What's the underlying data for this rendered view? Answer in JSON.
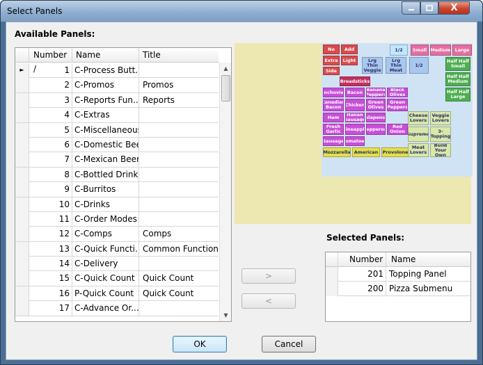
{
  "window": {
    "title": "Select Panels",
    "close_glyph": "X"
  },
  "available": {
    "label": "Available Panels:",
    "columns": [
      "Number /",
      "Name",
      "Title"
    ],
    "current_row_marker": "►",
    "rows": [
      {
        "number": "1",
        "name": "C-Process Butt...",
        "title": ""
      },
      {
        "number": "2",
        "name": "C-Promos",
        "title": "Promos"
      },
      {
        "number": "3",
        "name": "C-Reports Fun...",
        "title": "Reports"
      },
      {
        "number": "4",
        "name": "C-Extras",
        "title": ""
      },
      {
        "number": "5",
        "name": "C-Miscellaneous",
        "title": ""
      },
      {
        "number": "6",
        "name": "C-Domestic Beer",
        "title": ""
      },
      {
        "number": "7",
        "name": "C-Mexican Beer",
        "title": ""
      },
      {
        "number": "8",
        "name": "C-Bottled Drinks",
        "title": ""
      },
      {
        "number": "9",
        "name": "C-Burritos",
        "title": ""
      },
      {
        "number": "10",
        "name": "C-Drinks",
        "title": ""
      },
      {
        "number": "11",
        "name": "C-Order Modes",
        "title": ""
      },
      {
        "number": "12",
        "name": "C-Comps",
        "title": "Comps"
      },
      {
        "number": "13",
        "name": "C-Quick Functi...",
        "title": "Common Functions"
      },
      {
        "number": "14",
        "name": "C-Delivery",
        "title": ""
      },
      {
        "number": "15",
        "name": "C-Quick Count",
        "title": "Quick Count"
      },
      {
        "number": "16",
        "name": "P-Quick Count",
        "title": "Quick Count"
      },
      {
        "number": "17",
        "name": "C-Advance Or...",
        "title": ""
      }
    ]
  },
  "preview": {
    "tiles": [
      {
        "label": "No",
        "color": "#d94b4b"
      },
      {
        "label": "Add",
        "color": "#d94b4b"
      },
      {
        "label": "Extra",
        "color": "#d94b4b"
      },
      {
        "label": "Light",
        "color": "#d94b4b"
      },
      {
        "label": "Side",
        "color": "#d94b4b"
      },
      {
        "label": "Breadsticks",
        "color": "#c2305f"
      },
      {
        "label": "Lrg Thin Veggie",
        "color": "#a9c8ef"
      },
      {
        "label": "Lrg Thin Meat",
        "color": "#a9c8ef"
      },
      {
        "label": "1/2",
        "color": "#bfe7ff"
      },
      {
        "label": "1/2",
        "color": "#a9c8ef"
      },
      {
        "label": "Small",
        "color": "#e66fa0"
      },
      {
        "label": "Medium",
        "color": "#e66fa0"
      },
      {
        "label": "Large",
        "color": "#e66fa0"
      },
      {
        "label": "Half Half Small",
        "color": "#4fae52"
      },
      {
        "label": "Half Half Medium",
        "color": "#4fae52"
      },
      {
        "label": "Half Half Large",
        "color": "#4fae52"
      },
      {
        "label": "Anchovies",
        "color": "#c84fd8"
      },
      {
        "label": "Bacon",
        "color": "#c84fd8"
      },
      {
        "label": "Banana Peppers",
        "color": "#c84fd8"
      },
      {
        "label": "Black Olives",
        "color": "#c84fd8"
      },
      {
        "label": "Canadian Bacon",
        "color": "#c84fd8"
      },
      {
        "label": "Chicken",
        "color": "#c84fd8"
      },
      {
        "label": "Green Olives",
        "color": "#c84fd8"
      },
      {
        "label": "Green Peppers",
        "color": "#c84fd8"
      },
      {
        "label": "Ham",
        "color": "#c84fd8"
      },
      {
        "label": "Italian Sausage",
        "color": "#c84fd8"
      },
      {
        "label": "Jalapenos",
        "color": "#c84fd8"
      },
      {
        "label": "Fresh Garlic",
        "color": "#c84fd8"
      },
      {
        "label": "Pineapple",
        "color": "#c84fd8"
      },
      {
        "label": "Pepperoni",
        "color": "#c84fd8"
      },
      {
        "label": "Red Onion",
        "color": "#c84fd8"
      },
      {
        "label": "Sausage",
        "color": "#c84fd8"
      },
      {
        "label": "Tomatoes",
        "color": "#c84fd8"
      },
      {
        "label": "Mozzarella",
        "color": "#e2e04a"
      },
      {
        "label": "American",
        "color": "#e2e04a"
      },
      {
        "label": "Provolone",
        "color": "#e2e04a"
      },
      {
        "label": "Cheese Lovers",
        "color": "#d8e8a8"
      },
      {
        "label": "Veggie Lovers",
        "color": "#d8e8a8"
      },
      {
        "label": "Supreme",
        "color": "#d8e8a8"
      },
      {
        "label": "3-Topping",
        "color": "#d8e8a8"
      },
      {
        "label": "Meat Lovers",
        "color": "#d8e8a8"
      },
      {
        "label": "Build Your Own",
        "color": "#d8e8a8"
      }
    ]
  },
  "selected": {
    "label": "Selected Panels:",
    "columns": [
      "Number",
      "Name"
    ],
    "rows": [
      {
        "number": "201",
        "name": "Topping Panel"
      },
      {
        "number": "200",
        "name": "Pizza Submenu"
      }
    ]
  },
  "buttons": {
    "add": ">",
    "remove": "<",
    "ok": "OK",
    "cancel": "Cancel"
  }
}
